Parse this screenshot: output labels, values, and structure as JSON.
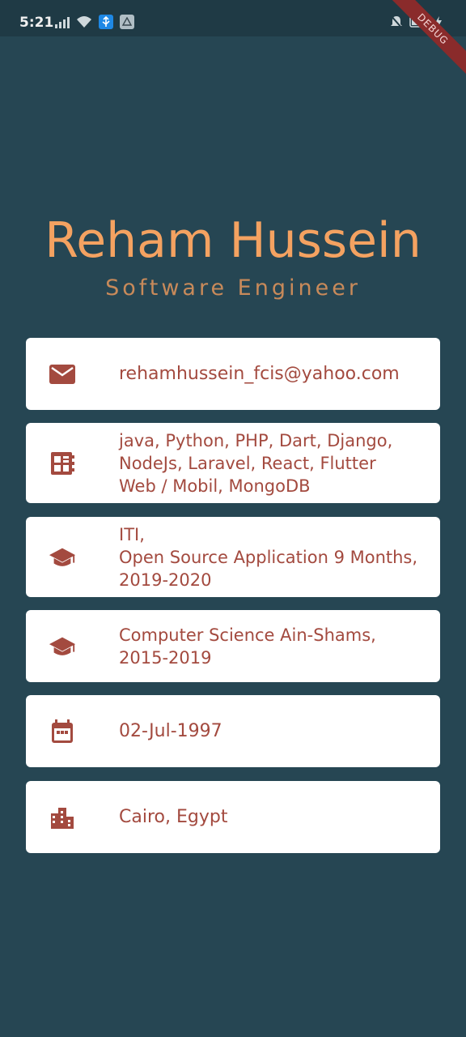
{
  "status_bar": {
    "time": "5:21",
    "icons_left": [
      "signal-icon",
      "wifi-icon",
      "usb-icon",
      "drive-icon"
    ],
    "icons_right": [
      "mute-icon",
      "battery-icon",
      "charging-icon"
    ]
  },
  "debug_banner": "DEBUG",
  "profile": {
    "name": "Reham Hussein",
    "title": "Software Engineer"
  },
  "cards": [
    {
      "icon": "email-icon",
      "text": "rehamhussein_fcis@yahoo.com"
    },
    {
      "icon": "skills-icon",
      "text": "java, Python, PHP, Dart, Django,\nNodeJs, Laravel, React, Flutter\nWeb / Mobil, MongoDB"
    },
    {
      "icon": "school-icon",
      "text": "ITI,\nOpen Source Application 9 Months,\n2019-2020"
    },
    {
      "icon": "school-icon",
      "text": "Computer Science Ain-Shams,\n2015-2019"
    },
    {
      "icon": "calendar-icon",
      "text": "02-Jul-1997"
    },
    {
      "icon": "city-icon",
      "text": "Cairo, Egypt"
    }
  ],
  "colors": {
    "background": "#264653",
    "name": "#f4a261",
    "card_text": "#a34a3f",
    "card_bg": "#ffffff"
  }
}
